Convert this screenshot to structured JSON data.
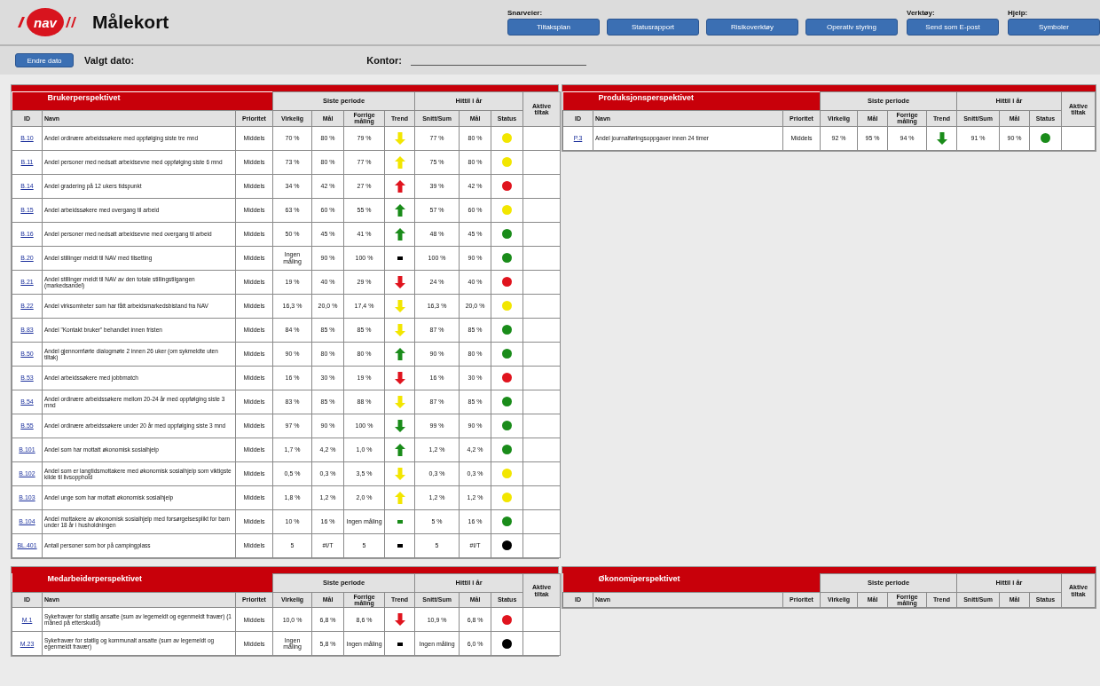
{
  "header": {
    "logo": "nav",
    "title": "Målekort",
    "groups": [
      {
        "label": "Snarveier:",
        "buttons": [
          "Tiltaksplan",
          "Statusrapport",
          "Risikoverktøy",
          "Operativ styring"
        ]
      },
      {
        "label": "Verktøy:",
        "buttons": [
          "Send som E-post"
        ]
      },
      {
        "label": "Hjelp:",
        "buttons": [
          "Symboler"
        ]
      }
    ]
  },
  "toolbar": {
    "button": "Endre dato",
    "date_label": "Valgt dato:",
    "office_label": "Kontor:"
  },
  "tables": [
    {
      "title": "Brukerperspektivet",
      "group_headers": [
        "Siste periode",
        "Hittil i år"
      ],
      "actions_header": "Aktive tiltak",
      "columns": [
        "ID",
        "Navn",
        "Prioritet",
        "Virkelig",
        "Mål",
        "Forrige måling",
        "Trend",
        "Snitt/Sum",
        "Mål",
        "Status"
      ],
      "rows": [
        {
          "id": "B.10",
          "name": "Andel ordinære arbeidssøkere med oppfølging siste tre mnd",
          "priority": "Middels",
          "actual": "70 %",
          "target": "80 %",
          "previous": "79 %",
          "trend": {
            "kind": "down",
            "color": "#f2e600"
          },
          "ytd": "77 %",
          "ytd_target": "80 %",
          "status": {
            "color": "#f2e600"
          }
        },
        {
          "id": "B.11",
          "name": "Andel personer med nedsatt arbeidsevne med oppfølging siste 6 mnd",
          "priority": "Middels",
          "actual": "73 %",
          "target": "80 %",
          "previous": "77 %",
          "trend": {
            "kind": "up",
            "color": "#f2e600"
          },
          "ytd": "75 %",
          "ytd_target": "80 %",
          "status": {
            "color": "#f2e600"
          }
        },
        {
          "id": "B.14",
          "name": "Andel gradering på 12 ukers tidspunkt",
          "priority": "Middels",
          "actual": "34 %",
          "target": "42 %",
          "previous": "27 %",
          "trend": {
            "kind": "up",
            "color": "#e0141e"
          },
          "ytd": "39 %",
          "ytd_target": "42 %",
          "status": {
            "color": "#e0141e"
          }
        },
        {
          "id": "B.15",
          "name": "Andel arbeidssøkere med overgang til arbeid",
          "priority": "Middels",
          "actual": "63 %",
          "target": "60 %",
          "previous": "55 %",
          "trend": {
            "kind": "up",
            "color": "#1a8c1a"
          },
          "ytd": "57 %",
          "ytd_target": "60 %",
          "status": {
            "color": "#f2e600"
          }
        },
        {
          "id": "B.16",
          "name": "Andel personer med nedsatt arbeidsevne med overgang til arbeid",
          "priority": "Middels",
          "actual": "50 %",
          "target": "45 %",
          "previous": "41 %",
          "trend": {
            "kind": "up",
            "color": "#1a8c1a"
          },
          "ytd": "48 %",
          "ytd_target": "45 %",
          "status": {
            "color": "#1a8c1a"
          }
        },
        {
          "id": "B.20",
          "name": "Andel stillinger meldt til NAV med tilsetting",
          "priority": "Middels",
          "actual": "Ingen måling",
          "target": "90 %",
          "previous": "100 %",
          "trend": {
            "kind": "flat",
            "color": "#000000"
          },
          "ytd": "100 %",
          "ytd_target": "90 %",
          "status": {
            "color": "#1a8c1a"
          }
        },
        {
          "id": "B.21",
          "name": "Andel stillinger meldt til NAV av den totale stillingstilgangen (markedsandel)",
          "priority": "Middels",
          "actual": "19 %",
          "target": "40 %",
          "previous": "29 %",
          "trend": {
            "kind": "down",
            "color": "#e0141e"
          },
          "ytd": "24 %",
          "ytd_target": "40 %",
          "status": {
            "color": "#e0141e"
          }
        },
        {
          "id": "B.22",
          "name": "Andel virksomheter som har fått arbeidsmarkedsbistand fra NAV",
          "priority": "Middels",
          "actual": "16,3 %",
          "target": "20,0 %",
          "previous": "17,4 %",
          "trend": {
            "kind": "down",
            "color": "#f2e600"
          },
          "ytd": "16,3 %",
          "ytd_target": "20,0 %",
          "status": {
            "color": "#f2e600"
          }
        },
        {
          "id": "B.83",
          "name": "Andel \"Kontakt bruker\" behandlet innen fristen",
          "priority": "Middels",
          "actual": "84 %",
          "target": "85 %",
          "previous": "85 %",
          "trend": {
            "kind": "down",
            "color": "#f2e600"
          },
          "ytd": "87 %",
          "ytd_target": "85 %",
          "status": {
            "color": "#1a8c1a"
          }
        },
        {
          "id": "B.50",
          "name": "Andel gjennomførte dialogmøte 2 innen 26 uker (om sykmeldte uten tiltak)",
          "priority": "Middels",
          "actual": "90 %",
          "target": "80 %",
          "previous": "80 %",
          "trend": {
            "kind": "up",
            "color": "#1a8c1a"
          },
          "ytd": "90 %",
          "ytd_target": "80 %",
          "status": {
            "color": "#1a8c1a"
          }
        },
        {
          "id": "B.53",
          "name": "Andel arbeidssøkere med jobbmatch",
          "priority": "Middels",
          "actual": "16 %",
          "target": "30 %",
          "previous": "19 %",
          "trend": {
            "kind": "down",
            "color": "#e0141e"
          },
          "ytd": "16 %",
          "ytd_target": "30 %",
          "status": {
            "color": "#e0141e"
          }
        },
        {
          "id": "B.54",
          "name": "Andel ordinære arbeidssøkere mellom 20-24 år med oppfølging siste 3 mnd",
          "priority": "Middels",
          "actual": "83 %",
          "target": "85 %",
          "previous": "88 %",
          "trend": {
            "kind": "down",
            "color": "#f2e600"
          },
          "ytd": "87 %",
          "ytd_target": "85 %",
          "status": {
            "color": "#1a8c1a"
          }
        },
        {
          "id": "B.55",
          "name": "Andel ordinære arbeidssøkere under 20 år med oppfølging siste 3 mnd",
          "priority": "Middels",
          "actual": "97 %",
          "target": "90 %",
          "previous": "100 %",
          "trend": {
            "kind": "down",
            "color": "#1a8c1a"
          },
          "ytd": "99 %",
          "ytd_target": "90 %",
          "status": {
            "color": "#1a8c1a"
          }
        },
        {
          "id": "B.101",
          "name": "Andel som har mottatt økonomisk sosialhjelp",
          "priority": "Middels",
          "actual": "1,7 %",
          "target": "4,2 %",
          "previous": "1,0 %",
          "trend": {
            "kind": "up",
            "color": "#1a8c1a"
          },
          "ytd": "1,2 %",
          "ytd_target": "4,2 %",
          "status": {
            "color": "#1a8c1a"
          }
        },
        {
          "id": "B.102",
          "name": "Andel som er langtidsmottakere med økonomisk sosialhjelp som viktigste kilde til livsopphold",
          "priority": "Middels",
          "actual": "0,5 %",
          "target": "0,3 %",
          "previous": "3,5 %",
          "trend": {
            "kind": "down",
            "color": "#f2e600"
          },
          "ytd": "0,3 %",
          "ytd_target": "0,3 %",
          "status": {
            "color": "#f2e600"
          }
        },
        {
          "id": "B.103",
          "name": "Andel unge som har mottatt økonomisk sosialhjelp",
          "priority": "Middels",
          "actual": "1,8 %",
          "target": "1,2 %",
          "previous": "2,0 %",
          "trend": {
            "kind": "up",
            "color": "#f2e600"
          },
          "ytd": "1,2 %",
          "ytd_target": "1,2 %",
          "status": {
            "color": "#f2e600"
          }
        },
        {
          "id": "B.104",
          "name": "Andel mottakere av økonomisk sosialhjelp med forsørgelsesplikt for barn under 18 år i husholdningen",
          "priority": "Middels",
          "actual": "10 %",
          "target": "16 %",
          "previous": "Ingen måling",
          "trend": {
            "kind": "flat",
            "color": "#1a8c1a"
          },
          "ytd": "5 %",
          "ytd_target": "16 %",
          "status": {
            "color": "#1a8c1a"
          }
        },
        {
          "id": "BL.401",
          "name": "Antall personer som bor på campingplass",
          "priority": "Middels",
          "actual": "5",
          "target": "#I/T",
          "previous": "5",
          "trend": {
            "kind": "flat",
            "color": "#000000"
          },
          "ytd": "5",
          "ytd_target": "#I/T",
          "status": {
            "color": "#000000"
          }
        }
      ]
    },
    {
      "title": "Produksjonsperspektivet",
      "group_headers": [
        "Siste periode",
        "Hittil i år"
      ],
      "actions_header": "Aktive tiltak",
      "columns": [
        "ID",
        "Navn",
        "Prioritet",
        "Virkelig",
        "Mål",
        "Forrige måling",
        "Trend",
        "Snitt/Sum",
        "Mål",
        "Status"
      ],
      "rows": [
        {
          "id": "P.3",
          "name": "Andel journalføringsoppgaver innen 24 timer",
          "priority": "Middels",
          "actual": "92 %",
          "target": "95 %",
          "previous": "94 %",
          "trend": {
            "kind": "down",
            "color": "#1a8c1a"
          },
          "ytd": "91 %",
          "ytd_target": "90 %",
          "status": {
            "color": "#1a8c1a"
          }
        }
      ]
    },
    {
      "title": "Medarbeiderperspektivet",
      "group_headers": [
        "Siste periode",
        "Hittil i år"
      ],
      "actions_header": "Aktive tiltak",
      "columns": [
        "ID",
        "Navn",
        "Prioritet",
        "Virkelig",
        "Mål",
        "Forrige måling",
        "Trend",
        "Snitt/Sum",
        "Mål",
        "Status"
      ],
      "rows": [
        {
          "id": "M.1",
          "name": "Sykefravær for statlig ansatte (sum av legemeldt og egenmeldt fravær) (1 måned på etterskudd)",
          "priority": "Middels",
          "actual": "10,0 %",
          "target": "6,8 %",
          "previous": "8,6 %",
          "trend": {
            "kind": "down",
            "color": "#e0141e"
          },
          "ytd": "10,9 %",
          "ytd_target": "6,8 %",
          "status": {
            "color": "#e0141e"
          }
        },
        {
          "id": "M.23",
          "name": "Sykefravær for statlig og kommunalt ansatte (sum av legemeldt og egenmeldt fravær)",
          "priority": "Middels",
          "actual": "Ingen måling",
          "target": "5,8 %",
          "previous": "Ingen måling",
          "trend": {
            "kind": "flat",
            "color": "#000000"
          },
          "ytd": "Ingen måling",
          "ytd_target": "6,0 %",
          "status": {
            "color": "#000000"
          }
        }
      ]
    },
    {
      "title": "Økonomiperspektivet",
      "group_headers": [
        "Siste periode",
        "Hittil i år"
      ],
      "actions_header": "Aktive tiltak",
      "columns": [
        "ID",
        "Navn",
        "Prioritet",
        "Virkelig",
        "Mål",
        "Forrige måling",
        "Trend",
        "Snitt/Sum",
        "Mål",
        "Status"
      ]
    }
  ]
}
